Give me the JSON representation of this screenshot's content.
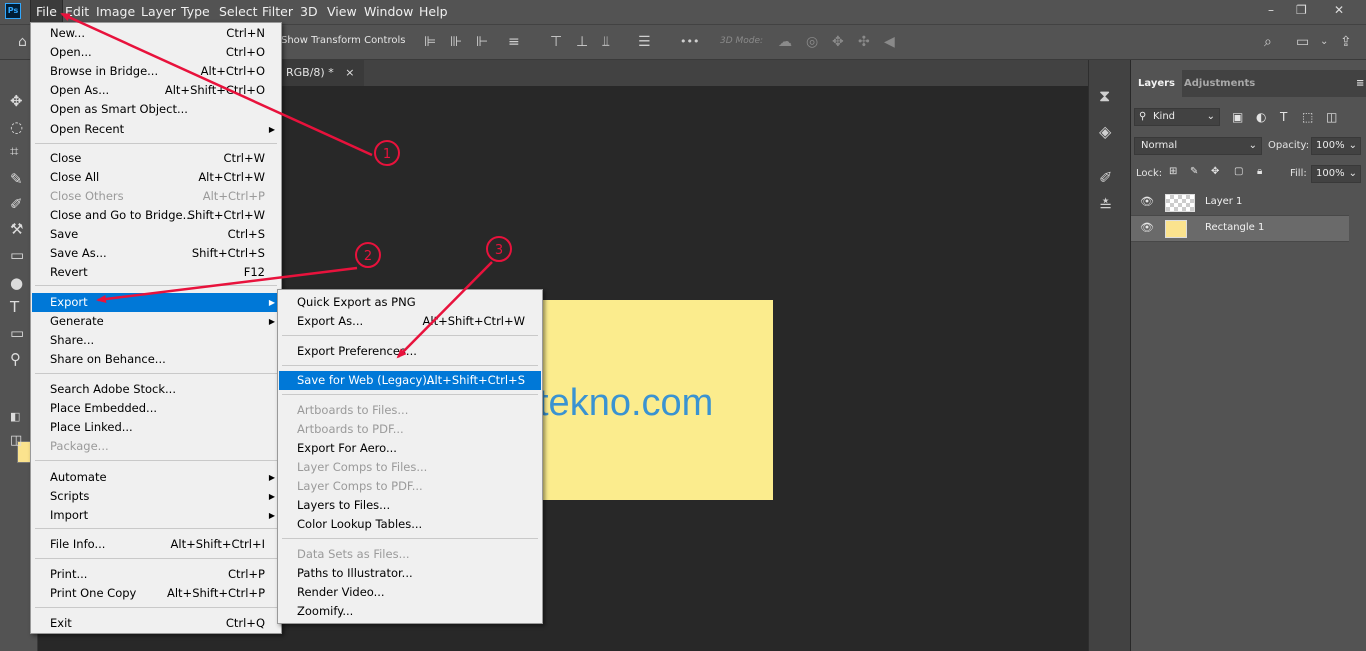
{
  "app": {
    "logo": "Ps"
  },
  "menubar": {
    "items": [
      "File",
      "Edit",
      "Image",
      "Layer",
      "Type",
      "Select",
      "Filter",
      "3D",
      "View",
      "Window",
      "Help"
    ],
    "window_controls": [
      "–",
      "❐",
      "✕"
    ]
  },
  "options_bar": {
    "transform_label": "Show Transform Controls",
    "mode_3d": "3D Mode:",
    "more": "•••"
  },
  "document": {
    "tab_title": "RGB/8) *",
    "tab_close": "×",
    "canvas_text": "tekno.com",
    "rect_color": "#fbec8d",
    "text_color": "#3a93d1"
  },
  "layers_panel": {
    "tabs": [
      "Layers",
      "Adjustments"
    ],
    "filter_kind": "Kind",
    "blend_mode": "Normal",
    "opacity_label": "Opacity:",
    "opacity_value": "100%",
    "lock_label": "Lock:",
    "fill_label": "Fill:",
    "fill_value": "100%",
    "layers": [
      {
        "name": "Layer 1"
      },
      {
        "name": "Rectangle 1"
      }
    ]
  },
  "file_menu": [
    {
      "label": "New...",
      "shortcut": "Ctrl+N"
    },
    {
      "label": "Open...",
      "shortcut": "Ctrl+O"
    },
    {
      "label": "Browse in Bridge...",
      "shortcut": "Alt+Ctrl+O"
    },
    {
      "label": "Open As...",
      "shortcut": "Alt+Shift+Ctrl+O"
    },
    {
      "label": "Open as Smart Object...",
      "shortcut": ""
    },
    {
      "label": "Open Recent",
      "shortcut": "",
      "submenu": true
    },
    {
      "label": "Close",
      "shortcut": "Ctrl+W"
    },
    {
      "label": "Close All",
      "shortcut": "Alt+Ctrl+W"
    },
    {
      "label": "Close Others",
      "shortcut": "Alt+Ctrl+P",
      "disabled": true
    },
    {
      "label": "Close and Go to Bridge...",
      "shortcut": "Shift+Ctrl+W"
    },
    {
      "label": "Save",
      "shortcut": "Ctrl+S"
    },
    {
      "label": "Save As...",
      "shortcut": "Shift+Ctrl+S"
    },
    {
      "label": "Revert",
      "shortcut": "F12"
    },
    {
      "label": "Export",
      "shortcut": "",
      "submenu": true,
      "selected": true
    },
    {
      "label": "Generate",
      "shortcut": "",
      "submenu": true
    },
    {
      "label": "Share...",
      "shortcut": ""
    },
    {
      "label": "Share on Behance...",
      "shortcut": ""
    },
    {
      "label": "Search Adobe Stock...",
      "shortcut": ""
    },
    {
      "label": "Place Embedded...",
      "shortcut": ""
    },
    {
      "label": "Place Linked...",
      "shortcut": ""
    },
    {
      "label": "Package...",
      "shortcut": "",
      "disabled": true
    },
    {
      "label": "Automate",
      "shortcut": "",
      "submenu": true
    },
    {
      "label": "Scripts",
      "shortcut": "",
      "submenu": true
    },
    {
      "label": "Import",
      "shortcut": "",
      "submenu": true
    },
    {
      "label": "File Info...",
      "shortcut": "Alt+Shift+Ctrl+I"
    },
    {
      "label": "Print...",
      "shortcut": "Ctrl+P"
    },
    {
      "label": "Print One Copy",
      "shortcut": "Alt+Shift+Ctrl+P"
    },
    {
      "label": "Exit",
      "shortcut": "Ctrl+Q"
    }
  ],
  "export_menu": [
    {
      "label": "Quick Export as PNG",
      "shortcut": ""
    },
    {
      "label": "Export As...",
      "shortcut": "Alt+Shift+Ctrl+W"
    },
    {
      "label": "Export Preferences...",
      "shortcut": ""
    },
    {
      "label": "Save for Web (Legacy)...",
      "shortcut": "Alt+Shift+Ctrl+S",
      "selected": true
    },
    {
      "label": "Artboards to Files...",
      "shortcut": "",
      "disabled": true
    },
    {
      "label": "Artboards to PDF...",
      "shortcut": "",
      "disabled": true
    },
    {
      "label": "Export For Aero...",
      "shortcut": ""
    },
    {
      "label": "Layer Comps to Files...",
      "shortcut": "",
      "disabled": true
    },
    {
      "label": "Layer Comps to PDF...",
      "shortcut": "",
      "disabled": true
    },
    {
      "label": "Layers to Files...",
      "shortcut": ""
    },
    {
      "label": "Color Lookup Tables...",
      "shortcut": ""
    },
    {
      "label": "Data Sets as Files...",
      "shortcut": "",
      "disabled": true
    },
    {
      "label": "Paths to Illustrator...",
      "shortcut": ""
    },
    {
      "label": "Render Video...",
      "shortcut": ""
    },
    {
      "label": "Zoomify...",
      "shortcut": ""
    }
  ],
  "annotations": {
    "step_labels": [
      "1",
      "2",
      "3"
    ],
    "arrow_color": "#e8123c"
  }
}
